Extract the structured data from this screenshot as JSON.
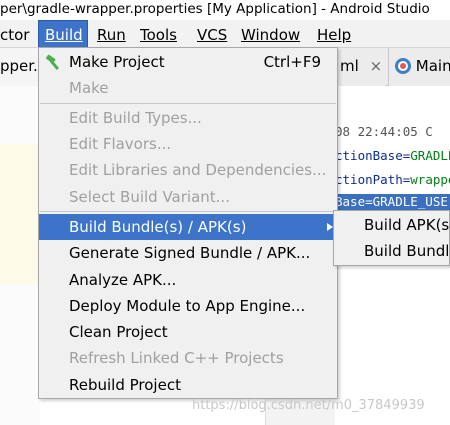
{
  "window": {
    "title": "per\\gradle-wrapper.properties [My Application] - Android Studio"
  },
  "menubar": {
    "items": [
      {
        "label": "ctor",
        "mnemonic": ""
      },
      {
        "label": "Build",
        "mnemonic": "B"
      },
      {
        "label": "Run",
        "mnemonic": "R"
      },
      {
        "label": "Tools",
        "mnemonic": "T"
      },
      {
        "label": "VCS",
        "mnemonic": "S"
      },
      {
        "label": "Window",
        "mnemonic": "W"
      },
      {
        "label": "Help",
        "mnemonic": "H"
      }
    ]
  },
  "tabs": {
    "left_fragment": "pper.p",
    "right_tab_1": "ml",
    "right_tab_1_close": "×",
    "right_tab_2": "Main"
  },
  "editor": {
    "timestamp_line": "08 22:44:05 C",
    "lines": [
      {
        "key": "ctionBase=",
        "val": "GRADLE"
      },
      {
        "key": "ctionPath=",
        "val": "wrappe"
      },
      {
        "key": "Base=GRADLE_USE",
        "val": ""
      }
    ]
  },
  "build_menu": {
    "items": [
      {
        "label": "Make Project",
        "shortcut": "Ctrl+F9",
        "enabled": true,
        "icon": "hammer-icon"
      },
      {
        "label": "Make",
        "enabled": false
      },
      {
        "label": "Edit Build Types...",
        "enabled": false
      },
      {
        "label": "Edit Flavors...",
        "enabled": false
      },
      {
        "label": "Edit Libraries and Dependencies...",
        "enabled": false
      },
      {
        "label": "Select Build Variant...",
        "enabled": false
      },
      {
        "label": "Build Bundle(s) / APK(s)",
        "enabled": true,
        "selected": true,
        "submenu": true
      },
      {
        "label": "Generate Signed Bundle / APK...",
        "enabled": true
      },
      {
        "label": "Analyze APK...",
        "enabled": true
      },
      {
        "label": "Deploy Module to App Engine...",
        "enabled": true
      },
      {
        "label": "Clean Project",
        "enabled": true
      },
      {
        "label": "Refresh Linked C++ Projects",
        "enabled": false
      },
      {
        "label": "Rebuild Project",
        "enabled": true
      }
    ]
  },
  "submenu": {
    "items": [
      {
        "label": "Build APK(s)"
      },
      {
        "label": "Build Bundle"
      }
    ]
  },
  "watermark": "https://blog.csdn.net/m0_37849939",
  "colors": {
    "selection": "#3d73c9",
    "disabled_text": "#a0a0a0",
    "menu_bg": "#f0f0f0",
    "hammer_green": "#4caf50"
  }
}
